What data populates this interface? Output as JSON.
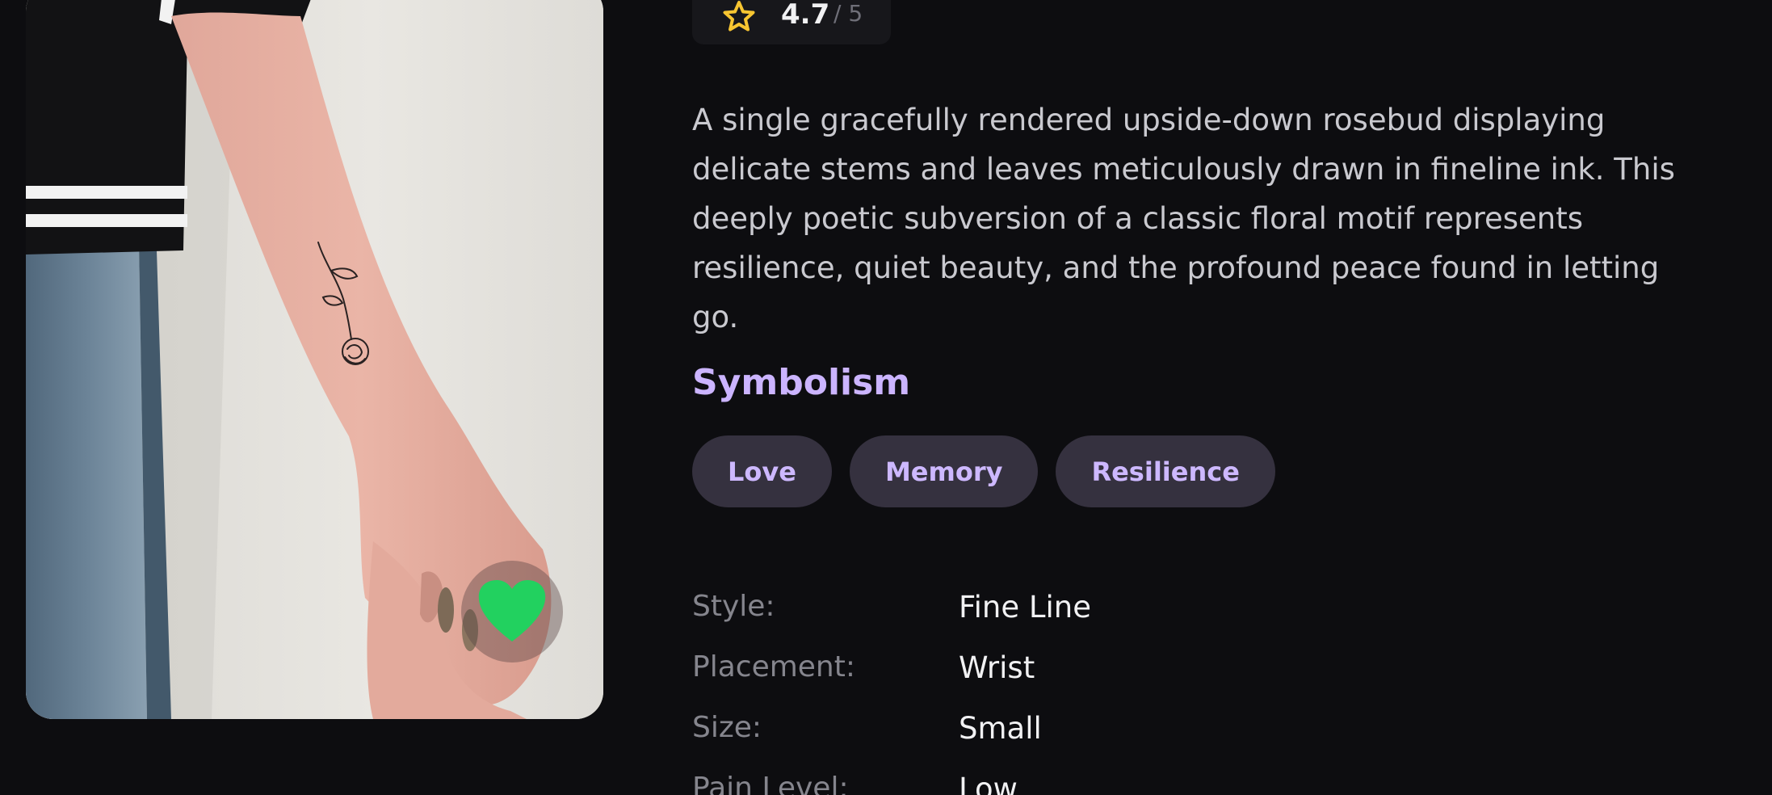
{
  "rating": {
    "value": "4.7",
    "max": "/ 5",
    "star_icon": "star-icon"
  },
  "image": {
    "alt": "Fine line upside-down rose tattoo on wrist",
    "favorite_icon": "heart-icon"
  },
  "description": "A single gracefully rendered upside-down rosebud displaying delicate stems and leaves meticulously drawn in fineline ink. This deeply poetic subversion of a classic floral motif represents resilience, quiet beauty, and the profound peace found in letting go.",
  "symbolism": {
    "title": "Symbolism",
    "tags": [
      "Love",
      "Memory",
      "Resilience"
    ]
  },
  "attributes": [
    {
      "label": "Style:",
      "value": "Fine Line"
    },
    {
      "label": "Placement:",
      "value": "Wrist"
    },
    {
      "label": "Size:",
      "value": "Small"
    },
    {
      "label": "Pain Level:",
      "value": "Low"
    }
  ],
  "colors": {
    "background": "#0d0d10",
    "accent": "#cbb4ff",
    "tag_background": "#35313f",
    "favorite": "#22d15f",
    "star": "#f7c531"
  }
}
